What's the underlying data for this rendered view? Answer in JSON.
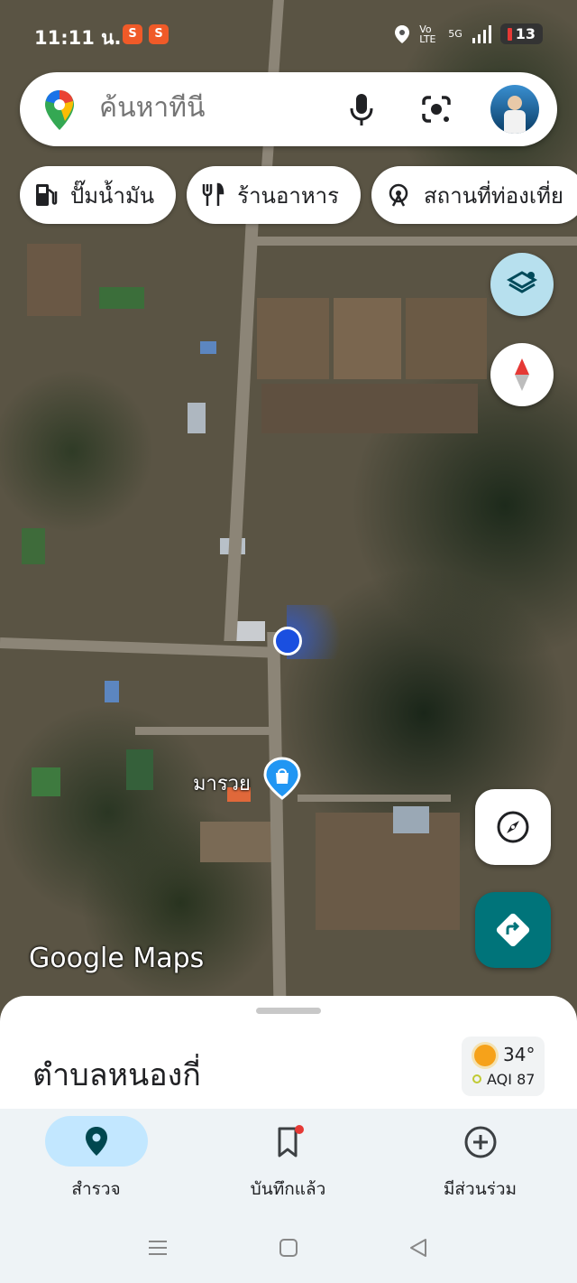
{
  "status_bar": {
    "time": "11:11 น.",
    "network": "5G",
    "battery": "13",
    "volte": "Vo LTE"
  },
  "search": {
    "placeholder": "ค้นหาที่นี่"
  },
  "chips": [
    {
      "icon": "gas-station-icon",
      "label": "ปั๊มน้ำมัน"
    },
    {
      "icon": "restaurant-icon",
      "label": "ร้านอาหาร"
    },
    {
      "icon": "attraction-icon",
      "label": "สถานที่ท่องเที่ย"
    }
  ],
  "map": {
    "place_label": "มารวย",
    "logo_text": "Google Maps"
  },
  "sheet": {
    "title": "ตำบลหนองกี่",
    "weather": {
      "temperature": "34°",
      "aqi": "AQI 87"
    }
  },
  "bottom_nav": [
    {
      "label": "สำรวจ",
      "icon": "explore-pin-icon",
      "selected": true
    },
    {
      "label": "บันทึกแล้ว",
      "icon": "bookmark-icon",
      "selected": false
    },
    {
      "label": "มีส่วนร่วม",
      "icon": "add-circle-icon",
      "selected": false
    }
  ],
  "colors": {
    "accent": "#00747a",
    "pill": "#c2e7ff",
    "location_dot": "#1a73e8"
  }
}
